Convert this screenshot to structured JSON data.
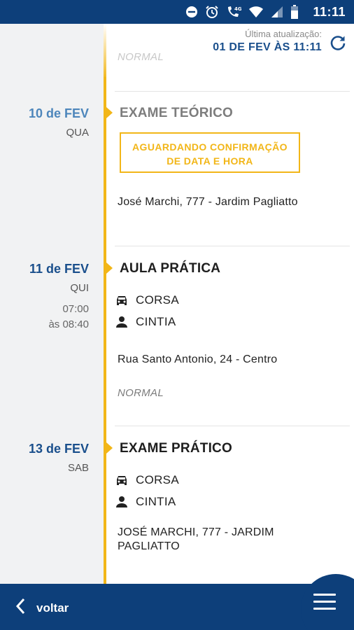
{
  "status_bar": {
    "time": "11:11",
    "network_label": "4G"
  },
  "header": {
    "last_update_label": "Última atualização:",
    "last_update_value": "01 DE FEV ÀS 11:11"
  },
  "previous_item": {
    "status": "NORMAL"
  },
  "events": [
    {
      "date": "10 de FEV",
      "weekday": "QUA",
      "title": "EXAME TEÓRICO",
      "pending_line1": "AGUARDANDO CONFIRMAÇÃO",
      "pending_line2": "DE DATA E HORA",
      "address": "José Marchi, 777 - Jardim Pagliatto"
    },
    {
      "date": "11 de FEV",
      "weekday": "QUI",
      "time_start": "07:00",
      "time_end": "às 08:40",
      "title": "AULA PRÁTICA",
      "vehicle": "CORSA",
      "instructor": "CINTIA",
      "address": "Rua Santo Antonio, 24 - Centro",
      "status": "NORMAL"
    },
    {
      "date": "13 de FEV",
      "weekday": "SAB",
      "title": "EXAME PRÁTICO",
      "vehicle": "CORSA",
      "instructor": "CINTIA",
      "address_line1": "JOSÉ MARCHI, 777 - JARDIM",
      "address_line2": "PAGLIATTO"
    }
  ],
  "bottom_bar": {
    "back_label": "voltar"
  },
  "icons": {
    "refresh": "refresh-icon",
    "car": "car-icon",
    "person": "person-icon",
    "back": "chevron-left-icon",
    "menu": "hamburger-menu-icon"
  },
  "colors": {
    "primary": "#0d3f7a",
    "accent": "#f2b618",
    "date_text": "#1a4f8c"
  }
}
